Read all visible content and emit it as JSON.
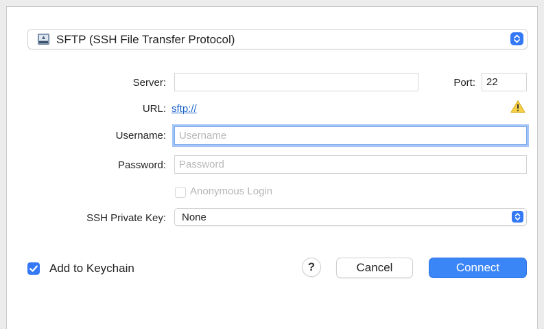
{
  "protocol": {
    "label": "SFTP (SSH File Transfer Protocol)",
    "icon": "network-drive-icon"
  },
  "server": {
    "label": "Server:",
    "value": "",
    "placeholder": ""
  },
  "port": {
    "label": "Port:",
    "value": "22"
  },
  "url": {
    "label": "URL:",
    "value": "sftp://"
  },
  "warning_icon": "warning-triangle-icon",
  "username": {
    "label": "Username:",
    "value": "",
    "placeholder": "Username"
  },
  "password": {
    "label": "Password:",
    "value": "",
    "placeholder": "Password"
  },
  "anonymous": {
    "label": "Anonymous Login",
    "checked": false,
    "enabled": false
  },
  "ssh_key": {
    "label": "SSH Private Key:",
    "value": "None"
  },
  "keychain": {
    "label": "Add to Keychain",
    "checked": true
  },
  "buttons": {
    "help": "?",
    "cancel": "Cancel",
    "connect": "Connect"
  },
  "colors": {
    "accent": "#3478f6",
    "link": "#1a62c8",
    "warning": "#f2c230"
  }
}
